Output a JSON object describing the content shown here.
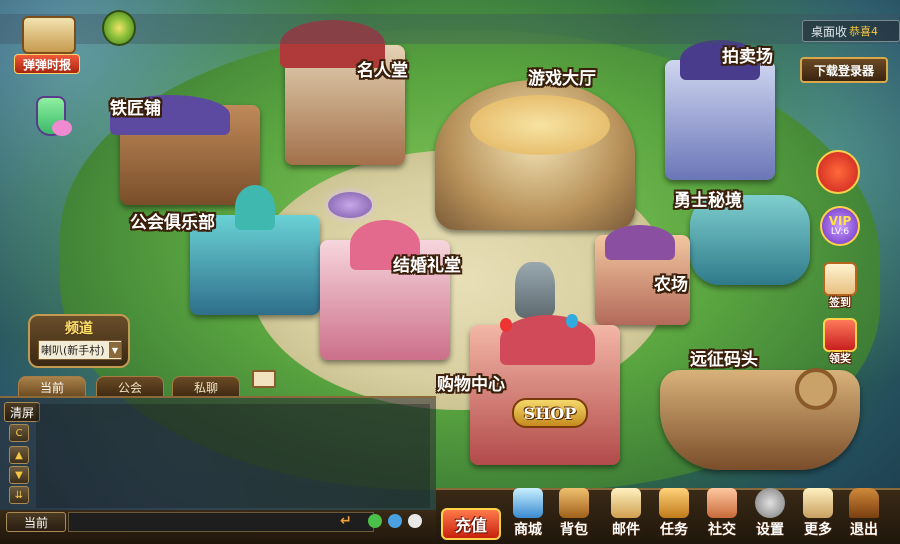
{
  "top": {
    "news_button": "弹弹时报",
    "desktop_shortcut": "桌面收",
    "desktop_shortcut_extra": "恭喜4",
    "download_login": "下载登录器"
  },
  "locations": {
    "blacksmith": "铁匠铺",
    "hall_of_fame": "名人堂",
    "game_hall": "游戏大厅",
    "auction": "拍卖场",
    "warrior_realm": "勇士秘境",
    "guild_club": "公会俱乐部",
    "wedding_hall": "结婚礼堂",
    "farm": "农场",
    "shopping_center": "购物中心",
    "expedition_dock": "远征码头",
    "shop_sign": "SHOP"
  },
  "right_panel": {
    "vip": "VIP",
    "vip_level": "LV:6",
    "checkin": "签到",
    "reward": "领奖"
  },
  "channel": {
    "title": "频道",
    "selected": "喇叭(新手村)"
  },
  "chat": {
    "tabs": [
      "当前",
      "公会",
      "私聊"
    ],
    "clear": "清屏",
    "current_label": "当前",
    "input_value": ""
  },
  "bottom": {
    "recharge": "充值",
    "menu": [
      "商城",
      "背包",
      "邮件",
      "任务",
      "社交",
      "设置",
      "更多",
      "退出"
    ]
  },
  "colors": {
    "accent_gold": "#f5c642",
    "label_outline": "#3a1f0a",
    "panel_bg": "#2a1d0e"
  }
}
